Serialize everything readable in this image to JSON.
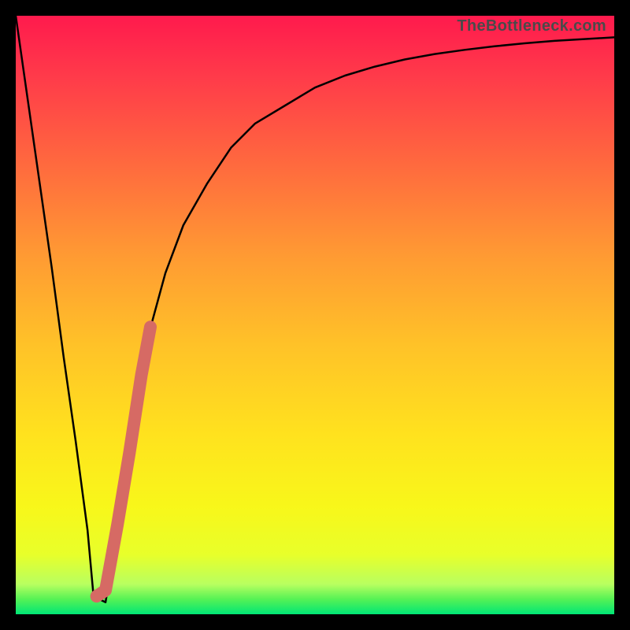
{
  "watermark": "TheBottleneck.com",
  "colors": {
    "background": "#000000",
    "curve": "#000000",
    "highlight": "#d66a64",
    "gradient_top": "#ff1a4d",
    "gradient_bottom": "#00e676"
  },
  "chart_data": {
    "type": "line",
    "title": "",
    "xlabel": "",
    "ylabel": "",
    "xlim": [
      0,
      100
    ],
    "ylim": [
      0,
      100
    ],
    "grid": false,
    "series": [
      {
        "name": "bottleneck-curve",
        "x": [
          0,
          2,
          4,
          6,
          8,
          10,
          12,
          13,
          15,
          17,
          20,
          22,
          25,
          28,
          32,
          36,
          40,
          45,
          50,
          55,
          60,
          65,
          70,
          75,
          80,
          85,
          90,
          95,
          100
        ],
        "y": [
          100,
          86,
          72,
          58,
          43,
          29,
          14,
          3,
          2,
          14,
          35,
          46,
          57,
          65,
          72,
          78,
          82,
          85,
          88,
          90,
          91.5,
          92.7,
          93.6,
          94.3,
          94.9,
          95.4,
          95.8,
          96.1,
          96.4
        ]
      }
    ],
    "highlight_segment": {
      "description": "thick salmon stroke over part of the rising branch near the bottom",
      "x": [
        13.5,
        15,
        17,
        19,
        21,
        22.5
      ],
      "y": [
        3,
        4,
        15,
        27,
        40,
        48
      ]
    }
  }
}
